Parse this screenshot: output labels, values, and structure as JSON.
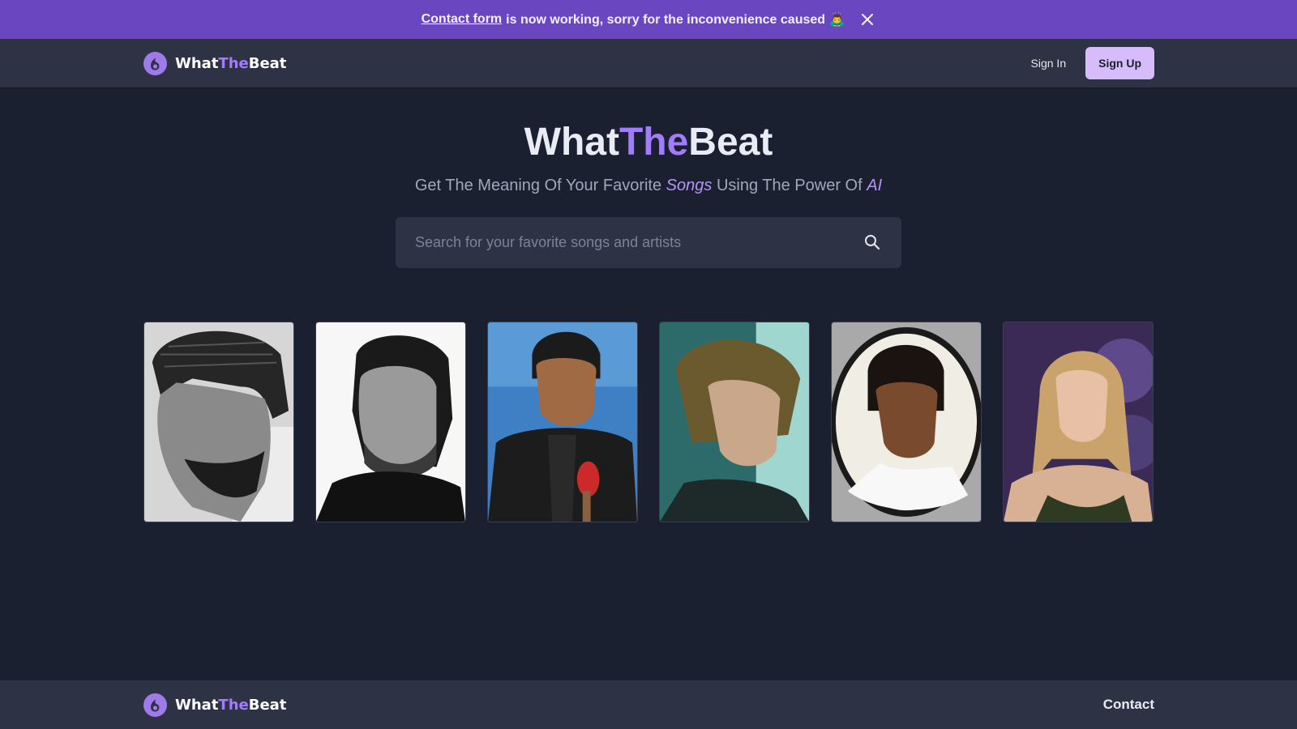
{
  "announcement": {
    "link_text": "Contact form",
    "message": "is now working, sorry for the inconvenience caused 🙇‍♂️"
  },
  "brand": {
    "part1": "What",
    "part2": "The",
    "part3": "Beat"
  },
  "nav": {
    "signin_label": "Sign In",
    "signup_label": "Sign Up"
  },
  "hero": {
    "title_part1": "What",
    "title_part2": "The",
    "title_part3": "Beat",
    "subtitle_part1": "Get The Meaning Of Your Favorite",
    "subtitle_songs": "Songs",
    "subtitle_part2": "Using The Power Of",
    "subtitle_ai": "AI"
  },
  "search": {
    "placeholder": "Search for your favorite songs and artists",
    "value": ""
  },
  "artists": [
    {
      "icon": "artist-portrait-bw-braids"
    },
    {
      "icon": "artist-portrait-bw"
    },
    {
      "icon": "artist-portrait-blue-microphone"
    },
    {
      "icon": "artist-portrait-teal"
    },
    {
      "icon": "artist-portrait-circle-frame"
    },
    {
      "icon": "artist-portrait-purple"
    }
  ],
  "footer": {
    "contact_label": "Contact"
  },
  "colors": {
    "banner": "#6b46c1",
    "accent": "#a37bff",
    "signup_bg": "#d6bcfa",
    "page_bg": "#1b2030",
    "panel_bg": "#2d3345"
  }
}
